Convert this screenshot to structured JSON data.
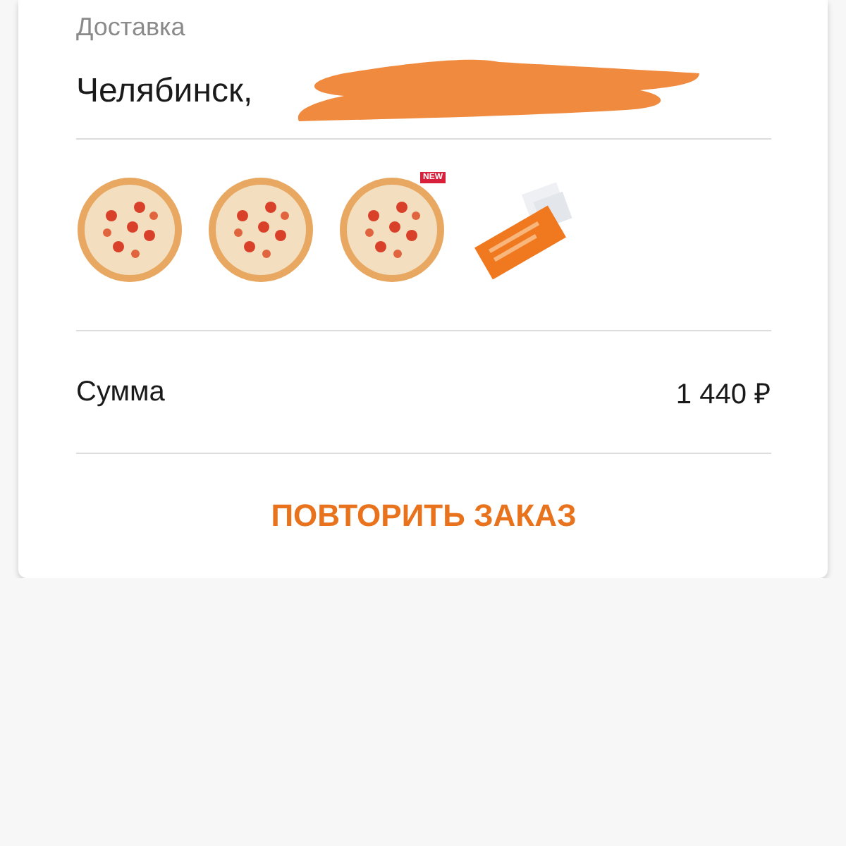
{
  "order": {
    "delivery_label": "Доставка",
    "address": "Челябинск,",
    "items": [
      {
        "kind": "pizza"
      },
      {
        "kind": "pizza"
      },
      {
        "kind": "pizza",
        "badge": "NEW"
      },
      {
        "kind": "package"
      }
    ],
    "total_label": "Сумма",
    "total_value": "1 440 ₽",
    "repeat_button": "ПОВТОРИТЬ ЗАКАЗ"
  }
}
